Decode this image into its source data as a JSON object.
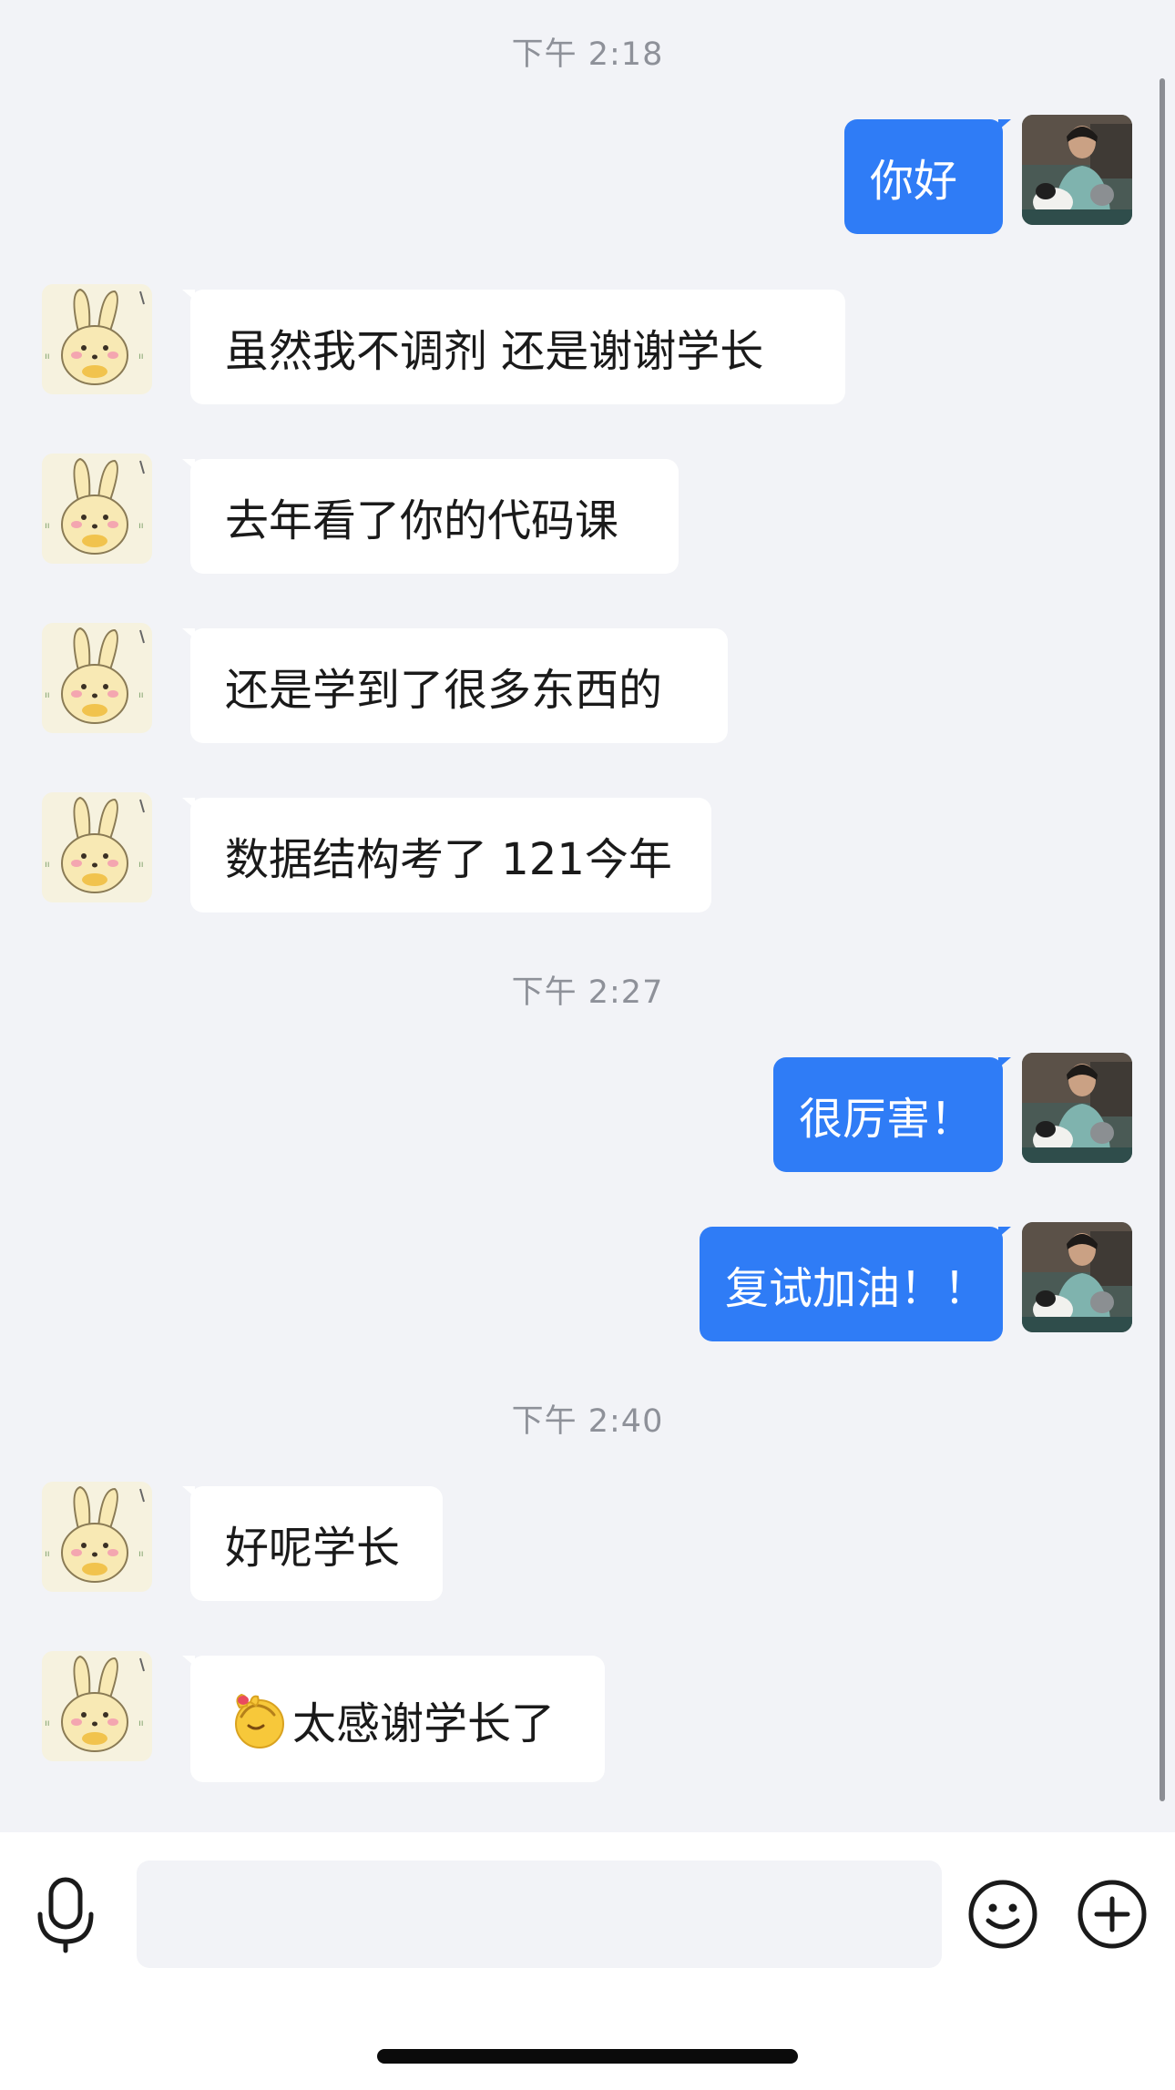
{
  "app": {
    "accent_color": "#2f7cf6",
    "background_color": "#f2f3f7"
  },
  "messages": [
    {
      "type": "timestamp",
      "text": "下午 2:18"
    },
    {
      "type": "outgoing",
      "text": "你好",
      "avatar": "person-with-cat-avatar"
    },
    {
      "type": "incoming",
      "text": "虽然我不调剂  还是谢谢学长",
      "avatar": "bunny-sticker-avatar"
    },
    {
      "type": "incoming",
      "text": "去年看了你的代码课",
      "avatar": "bunny-sticker-avatar"
    },
    {
      "type": "incoming",
      "text": "还是学到了很多东西的",
      "avatar": "bunny-sticker-avatar"
    },
    {
      "type": "incoming",
      "text": "数据结构考了 121今年",
      "avatar": "bunny-sticker-avatar"
    },
    {
      "type": "timestamp",
      "text": "下午 2:27"
    },
    {
      "type": "outgoing",
      "text": "很厉害！",
      "avatar": "person-with-cat-avatar"
    },
    {
      "type": "outgoing",
      "text": "复试加油！！",
      "avatar": "person-with-cat-avatar"
    },
    {
      "type": "timestamp",
      "text": "下午 2:40"
    },
    {
      "type": "incoming",
      "text": "好呢学长",
      "avatar": "bunny-sticker-avatar"
    },
    {
      "type": "incoming",
      "text": "太感谢学长了",
      "emoji": "bow-emoji",
      "avatar": "bunny-sticker-avatar"
    }
  ],
  "input_bar": {
    "voice_icon": "microphone-icon",
    "message_value": "",
    "message_placeholder": "",
    "emoji_icon": "smiley-icon",
    "more_icon": "plus-circle-icon"
  }
}
